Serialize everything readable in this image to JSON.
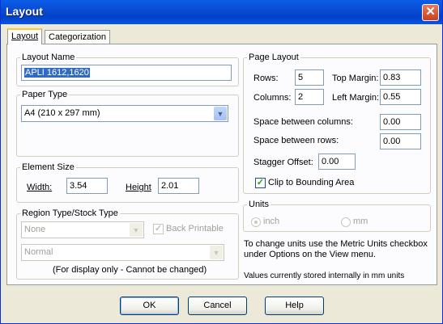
{
  "window": {
    "title": "Layout",
    "close_glyph": "✕"
  },
  "tabs": [
    {
      "label": "Layout"
    },
    {
      "label": "Categorization"
    }
  ],
  "layout_name": {
    "legend": "Layout Name",
    "value": "APLI 1612,1620"
  },
  "paper_type": {
    "legend": "Paper Type",
    "value": "A4 (210 x 297 mm)"
  },
  "element_size": {
    "legend": "Element Size",
    "width_label": "Width:",
    "width_value": "3.54",
    "height_label": "Height",
    "height_value": "2.01"
  },
  "region": {
    "legend": "Region Type/Stock Type",
    "type_value": "None",
    "back_printable_label": "Back Printable",
    "back_printable_checked": true,
    "stock_value": "Normal",
    "note": "(For display only - Cannot be changed)"
  },
  "page_layout": {
    "legend": "Page Layout",
    "rows_label": "Rows:",
    "rows_value": "5",
    "columns_label": "Columns:",
    "columns_value": "2",
    "top_margin_label": "Top Margin:",
    "top_margin_value": "0.83",
    "left_margin_label": "Left Margin:",
    "left_margin_value": "0.55",
    "space_columns_label": "Space between columns:",
    "space_columns_value": "0.00",
    "space_rows_label": "Space between rows:",
    "space_rows_value": "0.00",
    "stagger_label": "Stagger Offset:",
    "stagger_value": "0.00",
    "clip_label": "Clip to Bounding Area",
    "clip_checked": true
  },
  "units": {
    "legend": "Units",
    "inch_label": "inch",
    "mm_label": "mm",
    "selected": "inch"
  },
  "info": {
    "units_note": "To change units use the Metric Units checkbox under Options on the View menu.",
    "stored_note": "Values currently stored internally in mm units"
  },
  "buttons": {
    "ok": "OK",
    "cancel": "Cancel",
    "help": "Help"
  },
  "icons": {
    "checkmark": "✓",
    "dropdown_arrow": "▼"
  }
}
